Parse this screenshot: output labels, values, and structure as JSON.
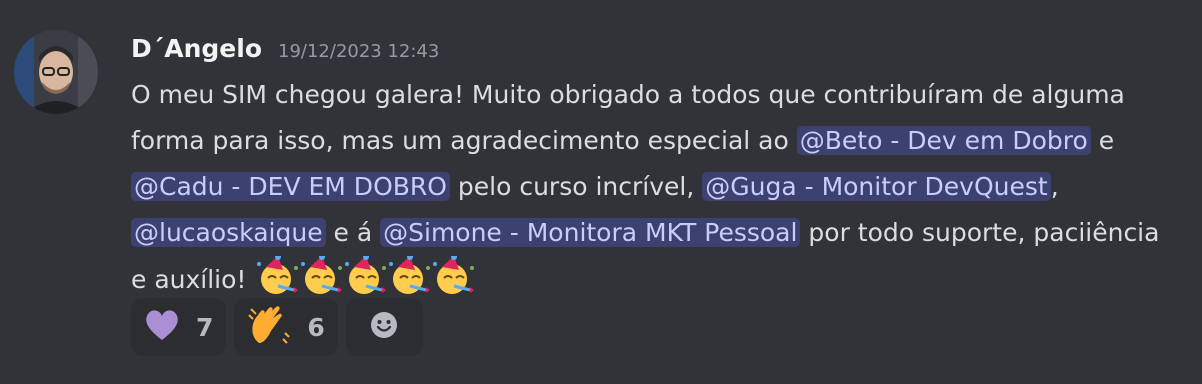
{
  "message": {
    "author": "D´Angelo",
    "timestamp": "19/12/2023 12:43",
    "content": {
      "text1": "O meu SIM chegou galera! Muito obrigado a todos que contribuíram de alguma forma para isso, mas um agradecimento especial ao ",
      "mention1": "@Beto - Dev em Dobro",
      "text2": " e ",
      "mention2": "@Cadu - DEV EM DOBRO",
      "text3": " pelo curso incrível, ",
      "mention3": "@Guga - Monitor DevQuest",
      "text4": ", ",
      "mention4": "@lucaoskaique",
      "text5": " e á ",
      "mention5": "@Simone - Monitora MKT Pessoal",
      "text6": " por todo suporte, paciiência e auxílio! ",
      "emojis": [
        "partying-face-emoji",
        "partying-face-emoji",
        "partying-face-emoji",
        "partying-face-emoji",
        "partying-face-emoji"
      ]
    },
    "reactions": [
      {
        "icon": "purple-heart-emoji",
        "count": "7"
      },
      {
        "icon": "clapping-hands-emoji",
        "count": "6"
      }
    ],
    "add_reaction_icon": "add-reaction-smiley-icon"
  },
  "colors": {
    "background": "#313338",
    "mention_bg": "#3c4270",
    "mention_text": "#c9cdfb",
    "text": "#dbdee1",
    "author": "#f2f3f5",
    "timestamp": "#949ba4"
  }
}
